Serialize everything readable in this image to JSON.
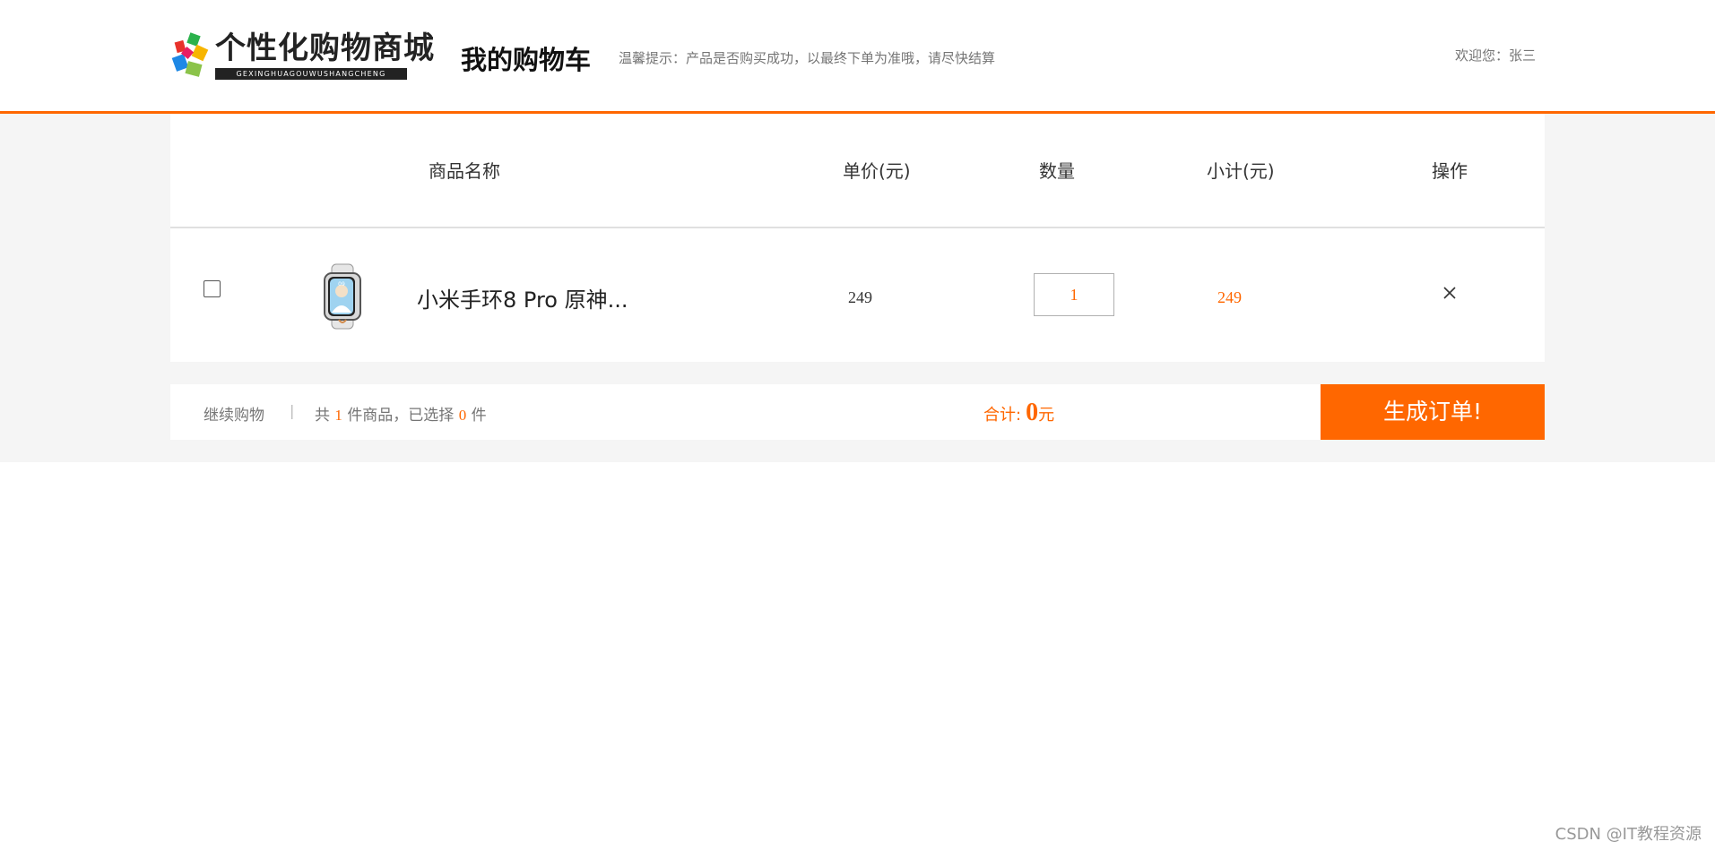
{
  "header": {
    "logo_title": "个性化购物商城",
    "logo_subtitle": "GEXINGHUAGOUWUSHANGCHENG",
    "page_title": "我的购物车",
    "tip": "温馨提示：产品是否购买成功，以最终下单为准哦，请尽快结算",
    "welcome": "欢迎您：张三"
  },
  "table": {
    "columns": [
      "商品名称",
      "单价(元)",
      "数量",
      "小计(元)",
      "操作"
    ],
    "rows": [
      {
        "checked": false,
        "image_icon": "smart-band-image",
        "name": "小米手环8 Pro 原神...",
        "price": "249",
        "quantity": "1",
        "subtotal": "249",
        "delete_symbol": "×"
      }
    ]
  },
  "footer": {
    "continue_label": "继续购物",
    "separator": "|",
    "count_prefix": "共",
    "total_count": "1",
    "count_mid": "件商品，已选择",
    "selected_count": "0",
    "count_suffix": "件",
    "total_label": "合计:",
    "total_amount": "0",
    "total_unit": "元",
    "order_button": "生成订单!"
  },
  "watermark": "CSDN @IT教程资源",
  "colors": {
    "accent": "#ff6700",
    "band_bg": "#f5f5f5",
    "text_muted": "#757575"
  }
}
